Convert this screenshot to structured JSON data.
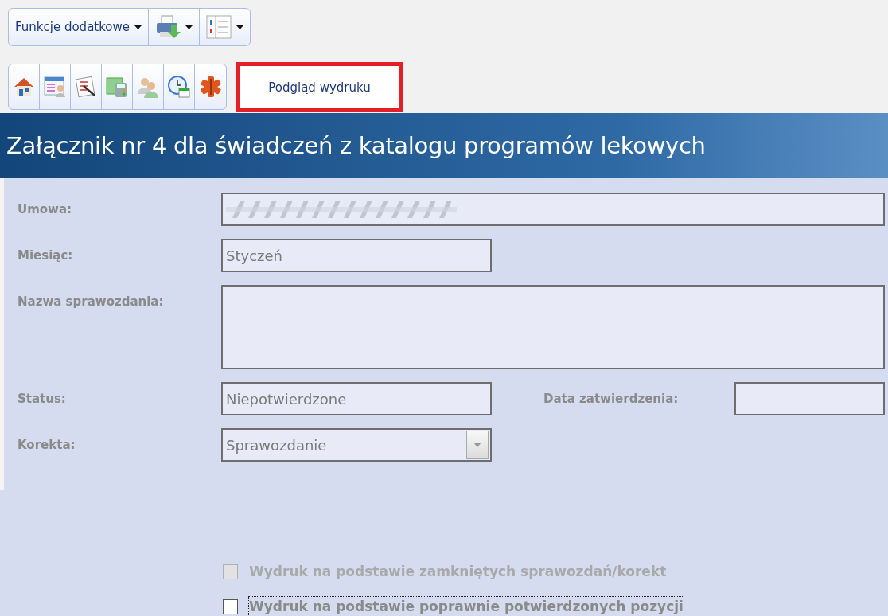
{
  "toolbar": {
    "menu_button": {
      "label": "Funkcje dodatkowe"
    },
    "preview_button": {
      "label": "Podgląd wydruku",
      "highlighted": true
    }
  },
  "title": "Załącznik nr 4 dla świadczeń z katalogu programów lekowych",
  "form": {
    "umowa": {
      "label": "Umowa:"
    },
    "miesiac": {
      "label": "Miesiąc:",
      "value": "Styczeń"
    },
    "nazwa": {
      "label": "Nazwa sprawozdania:"
    },
    "status": {
      "label": "Status:",
      "value": "Niepotwierdzone"
    },
    "data_zatwierdzenia": {
      "label": "Data zatwierdzenia:"
    },
    "korekta": {
      "label": "Korekta:",
      "value": "Sprawozdanie"
    }
  },
  "checkboxes": [
    {
      "label": "Wydruk na podstawie zamkniętych sprawozdań/korekt",
      "checked": false,
      "disabled": true,
      "focused": false
    },
    {
      "label": "Wydruk na podstawie poprawnie potwierdzonych pozycji",
      "checked": false,
      "disabled": false,
      "focused": true
    }
  ]
}
